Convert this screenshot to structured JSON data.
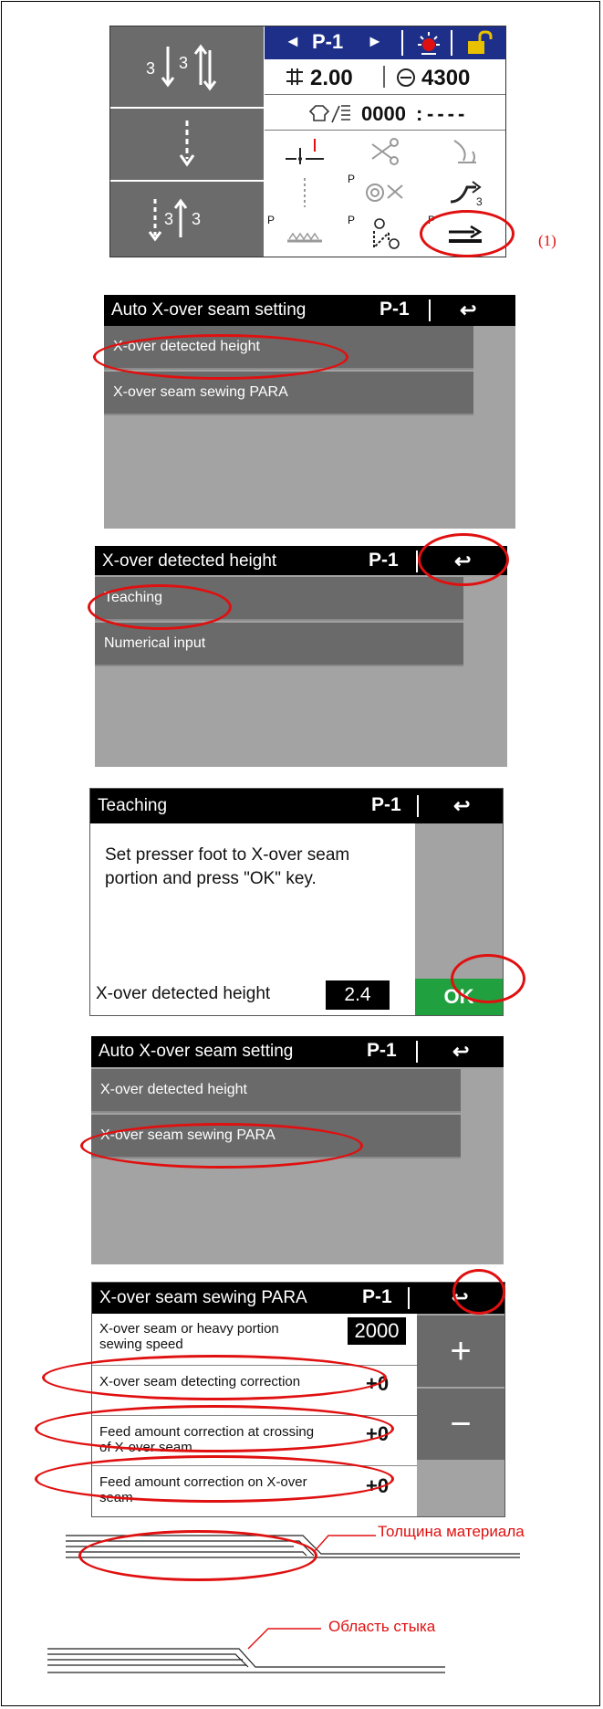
{
  "callout": "(1)",
  "main_screen": {
    "nav": {
      "prev": "◄",
      "label": "P-1",
      "next": "►"
    },
    "stitch_length": "2.00",
    "speed": "4300",
    "counter": "0000",
    "counter_extra": "----",
    "left_icons": [
      "start-backtack-icon",
      "continuous-stitch-icon",
      "end-backtack-icon"
    ],
    "left_digits": {
      "start_a": "3",
      "start_b": "3",
      "end_a": "3",
      "end_b": "3"
    },
    "grid_icons": [
      "needle-up-down-icon",
      "thread-trimmer-icon",
      "wiper-icon",
      "condensed-stitch-icon",
      "thread-trimmer-program-icon",
      "reverse-stitch-icon",
      "feed-dog-icon",
      "one-shot-stitch-icon",
      "auto-x-over-seam-icon"
    ],
    "grid_p_label": "P",
    "grid_small_digit": "3"
  },
  "auto_setting_1": {
    "title": "Auto X-over seam setting",
    "page": "P-1",
    "items": [
      "X-over detected height",
      "X-over seam sewing PARA"
    ]
  },
  "detected_height": {
    "title": "X-over detected height",
    "page": "P-1",
    "items": [
      "Teaching",
      "Numerical input"
    ]
  },
  "teaching": {
    "title": "Teaching",
    "page": "P-1",
    "message": "Set presser foot to X-over seam portion and press \"OK\" key.",
    "field_label": "X-over detected height",
    "field_value": "2.4",
    "ok_label": "OK",
    "ok_color": "#21a040"
  },
  "auto_setting_2": {
    "title": "Auto X-over seam setting",
    "page": "P-1",
    "items": [
      "X-over detected height",
      "X-over seam sewing PARA"
    ]
  },
  "sewing_para": {
    "title": "X-over seam sewing PARA",
    "page": "P-1",
    "rows": [
      {
        "label": "X-over seam or heavy portion sewing speed",
        "value": "2000"
      },
      {
        "label": "X-over seam detecting correction",
        "value": "+0"
      },
      {
        "label": "Feed amount correction at crossing of X-over seam",
        "value": "+0"
      },
      {
        "label": "Feed amount correction on X-over seam",
        "value": "+0"
      }
    ],
    "plus_label": "+",
    "minus_label": "−"
  },
  "diagrams": {
    "material_thickness_label": "Толщина материала",
    "joint_area_label": "Область стыка"
  },
  "colors": {
    "highlight": "#e01010",
    "title_bar": "#1e2f8a",
    "accent": "#e8c000"
  }
}
